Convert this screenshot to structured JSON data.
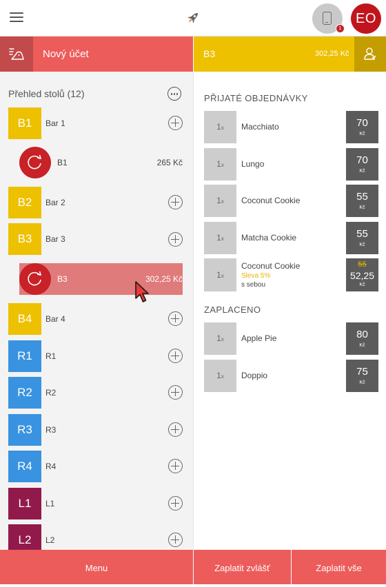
{
  "topbar": {
    "avatar_initials": "EO",
    "tablet_badge": "1",
    "icons": {
      "menu": "hamburger-icon",
      "brand": "rocket-icon",
      "device": "tablet-icon"
    }
  },
  "left_header": {
    "new_account_label": "Nový účet",
    "ticket_icon": "receipt-icon"
  },
  "right_header": {
    "table": "B3",
    "total": "302,25 Kč",
    "person_icon": "person-icon"
  },
  "overview": {
    "title": "Přehled stolů (12)",
    "tables": [
      {
        "code": "B1",
        "name": "Bar 1"
      },
      {
        "code": "B2",
        "name": "Bar 2"
      },
      {
        "code": "B3",
        "name": "Bar 3"
      },
      {
        "code": "B4",
        "name": "Bar 4"
      },
      {
        "code": "R1",
        "name": "R1"
      },
      {
        "code": "R2",
        "name": "R2"
      },
      {
        "code": "R3",
        "name": "R3"
      },
      {
        "code": "R4",
        "name": "R4"
      },
      {
        "code": "L1",
        "name": "L1"
      },
      {
        "code": "L2",
        "name": "L2"
      }
    ],
    "accounts": [
      {
        "name": "B1",
        "amount": "265 Kč"
      },
      {
        "name": "B3",
        "amount": "302,25 Kč",
        "selected": true
      }
    ]
  },
  "colors": {
    "bar": "#edc000",
    "restaurant": "#3a93e0",
    "lounge": "#921a4b",
    "accent_red": "#ec5c5b",
    "account_red": "#c82127"
  },
  "orders": {
    "received_title": "PŘIJATÉ OBJEDNÁVKY",
    "qty_suffix": "x",
    "received": [
      {
        "qty": "1",
        "name": "Macchiato",
        "price": "70",
        "currency": "Kč"
      },
      {
        "qty": "1",
        "name": "Lungo",
        "price": "70",
        "currency": "Kč"
      },
      {
        "qty": "1",
        "name": "Coconut Cookie",
        "price": "55",
        "currency": "Kč"
      },
      {
        "qty": "1",
        "name": "Matcha Cookie",
        "price": "55",
        "currency": "Kč"
      }
    ],
    "discounted": {
      "qty": "1",
      "name": "Coconut Cookie",
      "discount": "Sleva 5%",
      "note": "s sebou",
      "original_price": "55",
      "price": "52,25",
      "currency": "Kč"
    },
    "paid_title": "ZAPLACENO",
    "paid": [
      {
        "qty": "1",
        "name": "Apple Pie",
        "price": "80",
        "currency": "Kč"
      },
      {
        "qty": "1",
        "name": "Doppio",
        "price": "75",
        "currency": "Kč"
      }
    ]
  },
  "bottombar": {
    "menu_label": "Menu",
    "pay_separately_label": "Zaplatit zvlášť",
    "pay_all_label": "Zaplatit vše"
  }
}
